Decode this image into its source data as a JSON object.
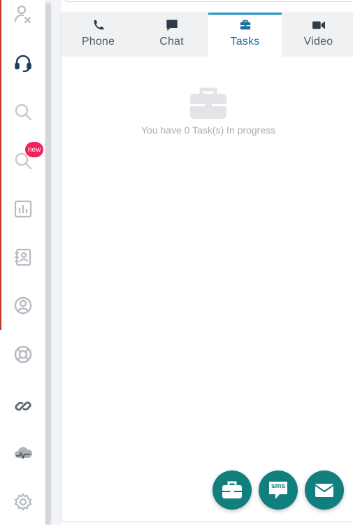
{
  "sidebar": {
    "icons": [
      {
        "name": "user-switch-icon"
      },
      {
        "name": "headset-icon"
      },
      {
        "name": "search-icon"
      },
      {
        "name": "search-new-icon"
      },
      {
        "name": "reports-icon"
      },
      {
        "name": "contacts-book-icon"
      },
      {
        "name": "user-circle-icon"
      },
      {
        "name": "lifebuoy-icon"
      },
      {
        "name": "link-icon"
      },
      {
        "name": "cloud-activity-icon"
      },
      {
        "name": "settings-gear-icon"
      }
    ],
    "badge_new": "new",
    "accent_color": "#c0392b",
    "icon_color": "#b7bcc2",
    "active_icon_color": "#1d3f63"
  },
  "tabs": [
    {
      "label": "Phone",
      "icon": "phone-icon",
      "active": false
    },
    {
      "label": "Chat",
      "icon": "chat-icon",
      "active": false
    },
    {
      "label": "Tasks",
      "icon": "briefcase-icon",
      "active": true
    },
    {
      "label": "Video",
      "icon": "video-icon",
      "active": false
    }
  ],
  "empty_state": {
    "icon": "briefcase-icon",
    "message": "You have 0 Task(s) In progress"
  },
  "fabs": [
    {
      "name": "new-task-fab",
      "icon": "briefcase-icon"
    },
    {
      "name": "sms-fab",
      "icon": "sms-bubble-icon",
      "label": "sms"
    },
    {
      "name": "email-fab",
      "icon": "envelope-icon"
    }
  ],
  "colors": {
    "fab": "#127f7f",
    "active_tab_border": "#2196c9",
    "active_tab_text": "#1f6fa3",
    "badge": "#f0245c"
  }
}
